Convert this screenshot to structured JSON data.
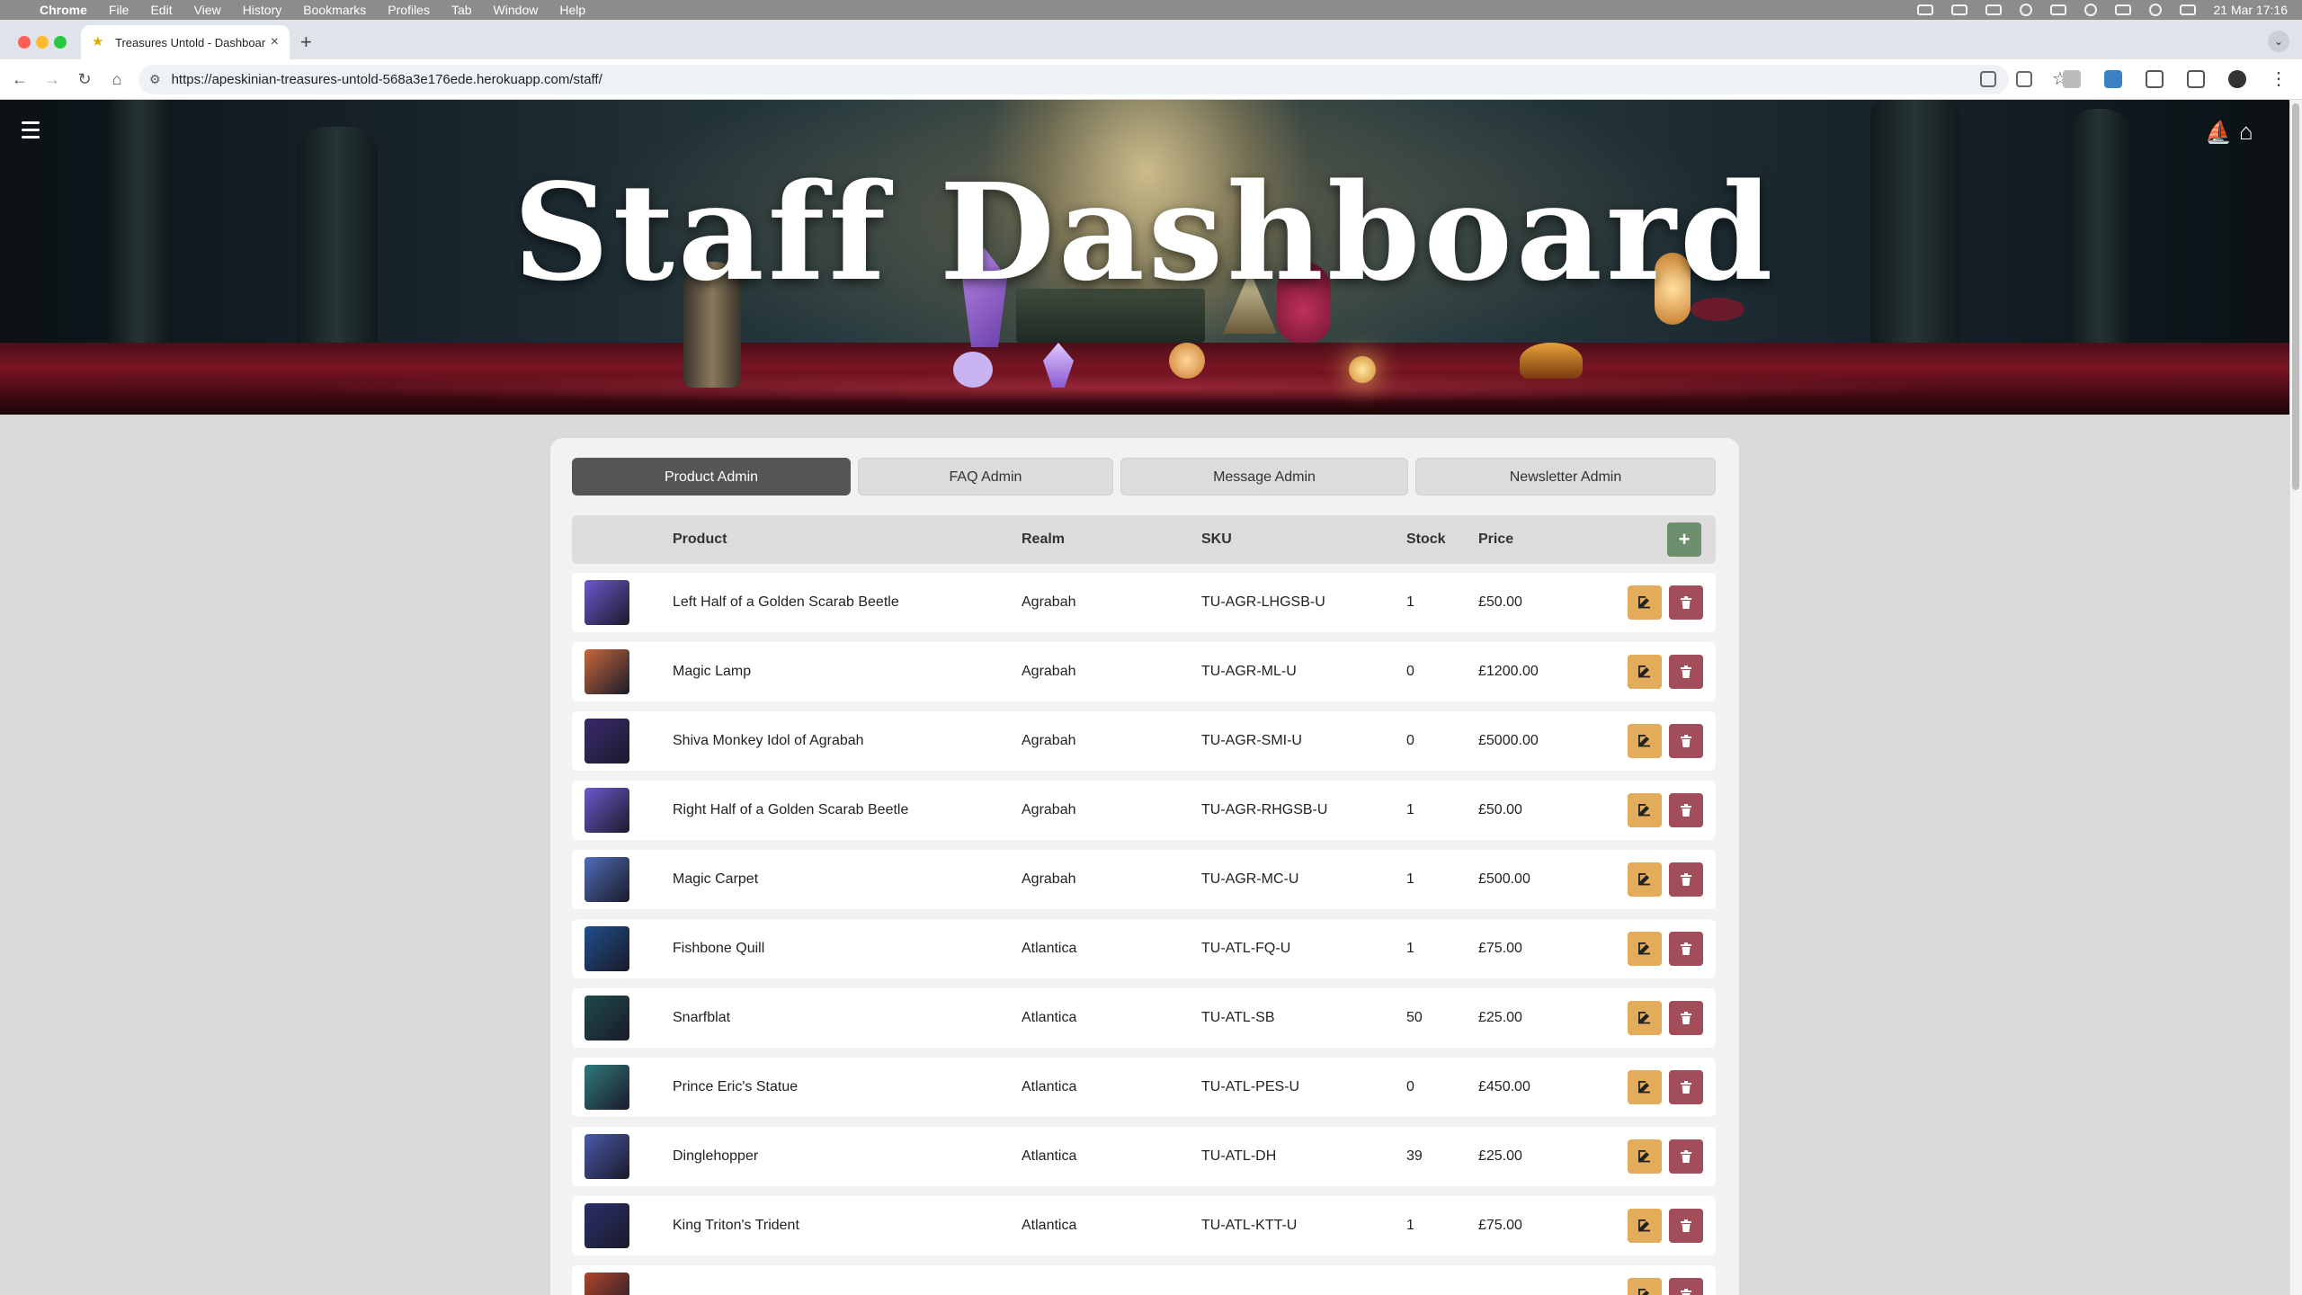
{
  "os_menubar": {
    "app_name": "Chrome",
    "menus": [
      "File",
      "Edit",
      "View",
      "History",
      "Bookmarks",
      "Profiles",
      "Tab",
      "Window",
      "Help"
    ],
    "clock": "21 Mar  17:16"
  },
  "browser": {
    "tab_title": "Treasures Untold - Dashboard",
    "url": "https://apeskinian-treasures-untold-568a3e176ede.herokuapp.com/staff/"
  },
  "hero": {
    "title": "Staff Dashboard"
  },
  "admin_tabs": [
    {
      "label": "Product Admin",
      "active": true
    },
    {
      "label": "FAQ Admin",
      "active": false
    },
    {
      "label": "Message Admin",
      "active": false
    },
    {
      "label": "Newsletter Admin",
      "active": false
    }
  ],
  "table": {
    "headers": {
      "product": "Product",
      "realm": "Realm",
      "sku": "SKU",
      "stock": "Stock",
      "price": "Price"
    },
    "add_label": "+",
    "rows": [
      {
        "product": "Left Half of a Golden Scarab Beetle",
        "realm": "Agrabah",
        "sku": "TU-AGR-LHGSB-U",
        "stock": "1",
        "price": "£50.00",
        "thumb_color": "#6a5acd"
      },
      {
        "product": "Magic Lamp",
        "realm": "Agrabah",
        "sku": "TU-AGR-ML-U",
        "stock": "0",
        "price": "£1200.00",
        "thumb_color": "#c7683a"
      },
      {
        "product": "Shiva Monkey Idol of Agrabah",
        "realm": "Agrabah",
        "sku": "TU-AGR-SMI-U",
        "stock": "0",
        "price": "£5000.00",
        "thumb_color": "#3b2a6e"
      },
      {
        "product": "Right Half of a Golden Scarab Beetle",
        "realm": "Agrabah",
        "sku": "TU-AGR-RHGSB-U",
        "stock": "1",
        "price": "£50.00",
        "thumb_color": "#6a5acd"
      },
      {
        "product": "Magic Carpet",
        "realm": "Agrabah",
        "sku": "TU-AGR-MC-U",
        "stock": "1",
        "price": "£500.00",
        "thumb_color": "#4f6db8"
      },
      {
        "product": "Fishbone Quill",
        "realm": "Atlantica",
        "sku": "TU-ATL-FQ-U",
        "stock": "1",
        "price": "£75.00",
        "thumb_color": "#1f4e8c"
      },
      {
        "product": "Snarfblat",
        "realm": "Atlantica",
        "sku": "TU-ATL-SB",
        "stock": "50",
        "price": "£25.00",
        "thumb_color": "#1e4b4a"
      },
      {
        "product": "Prince Eric's Statue",
        "realm": "Atlantica",
        "sku": "TU-ATL-PES-U",
        "stock": "0",
        "price": "£450.00",
        "thumb_color": "#2f7a7a"
      },
      {
        "product": "Dinglehopper",
        "realm": "Atlantica",
        "sku": "TU-ATL-DH",
        "stock": "39",
        "price": "£25.00",
        "thumb_color": "#4a5aa8"
      },
      {
        "product": "King Triton's Trident",
        "realm": "Atlantica",
        "sku": "TU-ATL-KTT-U",
        "stock": "1",
        "price": "£75.00",
        "thumb_color": "#2a2f6a"
      },
      {
        "product": "",
        "realm": "",
        "sku": "",
        "stock": "",
        "price": "",
        "thumb_color": "#b0452a"
      }
    ]
  },
  "colors": {
    "edit_button": "#e3ac5b",
    "delete_button": "#a24d5a",
    "add_button": "#6d8f6d",
    "active_tab": "#555555"
  }
}
